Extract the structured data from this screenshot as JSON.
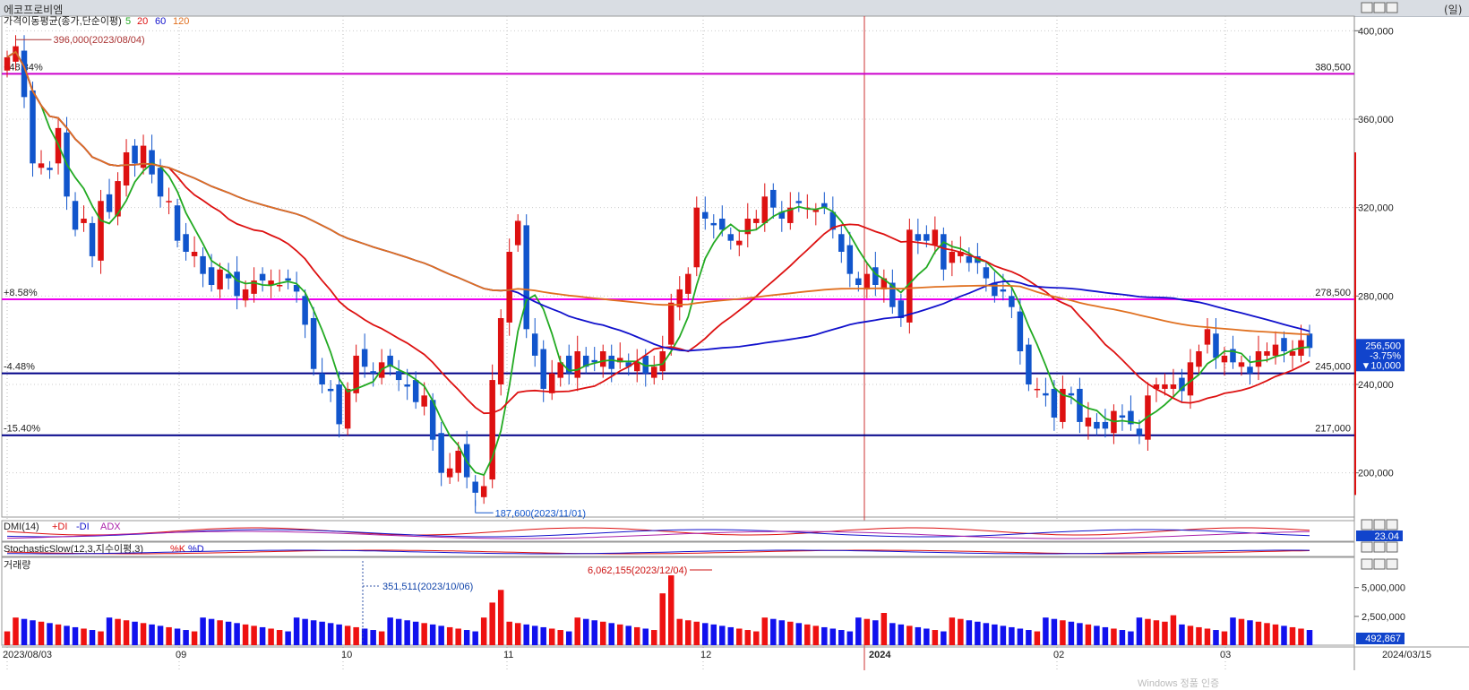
{
  "window": {
    "title": "에코프로비엠",
    "unit_label": "(일)"
  },
  "legend": {
    "name": "가격이동평균(종가,단순이평)",
    "periods": [
      "5",
      "20",
      "60",
      "120"
    ],
    "colors": [
      "#22aa22",
      "#dd1111",
      "#1111cc",
      "#e07020"
    ]
  },
  "panels": {
    "dmi": {
      "name": "DMI(14)",
      "items": [
        "+DI",
        "-DI",
        "ADX"
      ],
      "colors": [
        "#dd1111",
        "#1111cc",
        "#aa22aa"
      ],
      "value": "23.04"
    },
    "stoch": {
      "name": "StochasticSlow(12,3,지수이평,3)",
      "items": [
        "%K",
        "%D"
      ],
      "colors": [
        "#dd1111",
        "#1111cc"
      ]
    },
    "volume": {
      "name": "거래량"
    }
  },
  "price_axis_labels": [
    "400,000",
    "360,000",
    "320,000",
    "280,000",
    "240,000",
    "200,000"
  ],
  "volume_axis_labels": [
    "5,000,000",
    "2,500,000"
  ],
  "date_labels": [
    "2023/08/03",
    "09",
    "10",
    "11",
    "12",
    "2024",
    "02",
    "03",
    "2024/03/15"
  ],
  "horizontal_lines": [
    {
      "value": 380500,
      "label": "380,500",
      "pct": "+48.34%",
      "color": "#cc00cc"
    },
    {
      "value": 278500,
      "label": "278,500",
      "pct": "+8.58%",
      "color": "#ee00ee"
    },
    {
      "value": 245000,
      "label": "245,000",
      "pct": "-4.48%",
      "color": "#000088"
    },
    {
      "value": 217000,
      "label": "217,000",
      "pct": "-15.40%",
      "color": "#000088"
    }
  ],
  "annotations": {
    "high": "396,000(2023/08/04)",
    "low": "187,600(2023/11/01)",
    "vol_mark": "351,511(2023/10/06)",
    "vol_high": "6,062,155(2023/12/04)"
  },
  "current": {
    "price": "256,500",
    "change": "-3.75%",
    "diff": "▼10,000",
    "volume": "492,867"
  },
  "watermark": "Windows 정품 인증",
  "chart_data": {
    "type": "candlestick",
    "price_range": [
      180000,
      405000
    ],
    "volume_range": [
      0,
      7000000
    ],
    "candles_close": [
      388000,
      393000,
      370000,
      340000,
      340000,
      337000,
      356000,
      325000,
      310000,
      315000,
      298000,
      323000,
      318000,
      332000,
      345000,
      340000,
      348000,
      335000,
      325000,
      323000,
      305000,
      300000,
      300000,
      290000,
      285000,
      292000,
      288000,
      280000,
      283000,
      287000,
      287000,
      287000,
      285000,
      287000,
      282000,
      267000,
      247000,
      240000,
      237000,
      222000,
      238000,
      253000,
      248000,
      245000,
      250000,
      248000,
      242000,
      239000,
      232000,
      235000,
      215000,
      200000,
      202000,
      210000,
      198000,
      191000,
      194000,
      242000,
      270000,
      300000,
      314000,
      265000,
      253000,
      238000,
      245000,
      250000,
      245000,
      255000,
      248000,
      250000,
      255000,
      247000,
      252000,
      248000,
      250000,
      245000,
      248000,
      255000,
      277000,
      283000,
      290000,
      320000,
      315000,
      312000,
      310000,
      305000,
      305000,
      315000,
      315000,
      325000,
      320000,
      315000,
      320000,
      322000,
      320000,
      319000,
      320000,
      310000,
      300000,
      290000,
      285000,
      290000,
      285000,
      288000,
      275000,
      270000,
      310000,
      305000,
      305000,
      310000,
      292000,
      300000,
      300000,
      295000,
      295000,
      288000,
      280000,
      282000,
      275000,
      255000,
      240000,
      238000,
      235000,
      225000,
      238000,
      235000,
      223000,
      225000,
      220000,
      220000,
      228000,
      225000,
      222000,
      217000,
      235000,
      240000,
      240000,
      240000,
      237000,
      250000,
      255000,
      265000,
      252000,
      253000,
      250000,
      250000,
      245000,
      255000,
      255000,
      258000,
      255000,
      255000,
      260000,
      256500
    ]
  }
}
